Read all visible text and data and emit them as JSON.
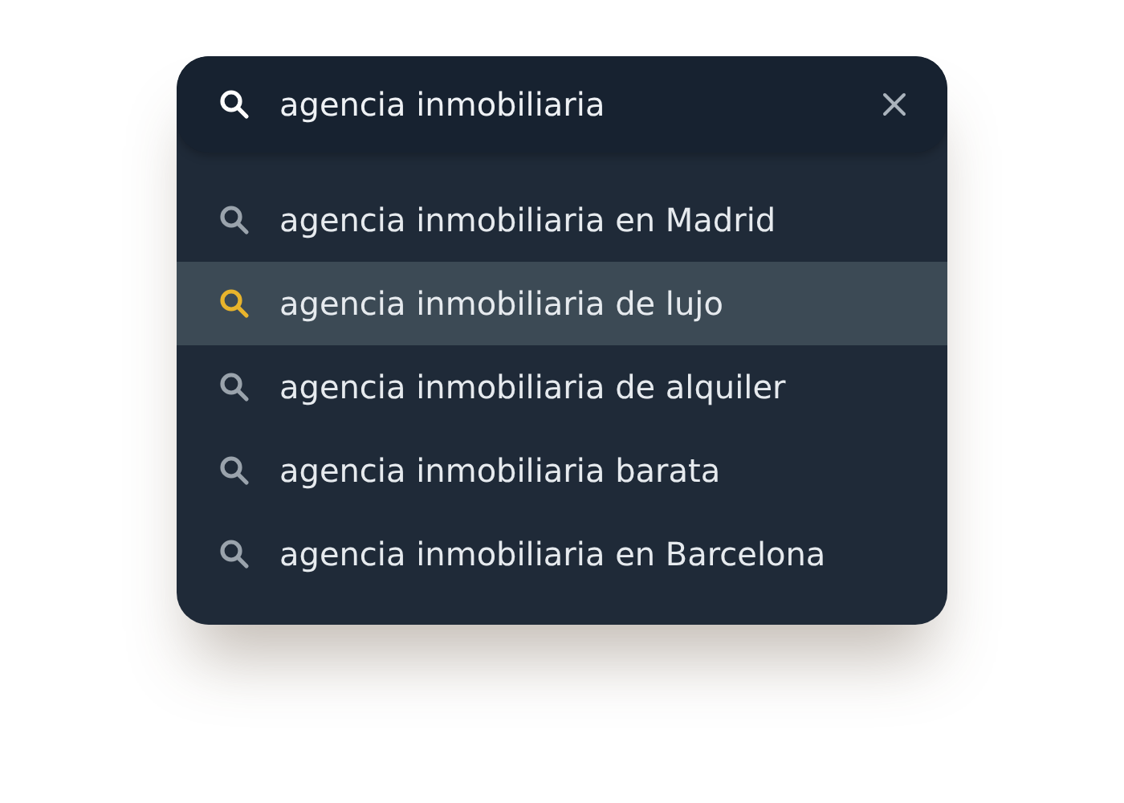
{
  "search": {
    "value": "agencia inmobiliaria"
  },
  "suggestions": [
    {
      "text": "agencia inmobiliaria en Madrid",
      "selected": false
    },
    {
      "text": "agencia inmobiliaria de lujo",
      "selected": true
    },
    {
      "text": "agencia inmobiliaria de alquiler",
      "selected": false
    },
    {
      "text": "agencia inmobiliaria barata",
      "selected": false
    },
    {
      "text": "agencia inmobiliaria en Barcelona",
      "selected": false
    }
  ]
}
